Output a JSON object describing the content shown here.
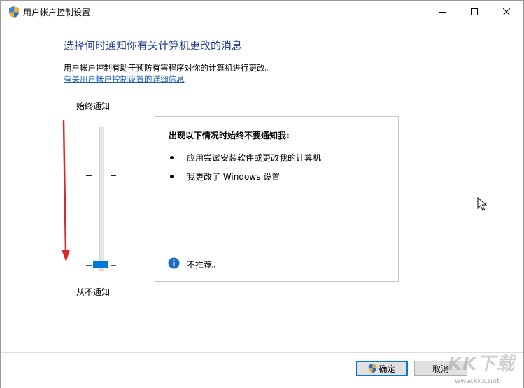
{
  "window": {
    "title": "用户帐户控制设置",
    "controls": {
      "minimize": "minimize-icon",
      "maximize": "maximize-icon",
      "close": "close-icon"
    }
  },
  "main": {
    "heading": "选择何时通知你有关计算机更改的消息",
    "description": "用户帐户控制有助于预防有害程序对你的计算机进行更改。",
    "link": "有关用户帐户控制设置的详细信息"
  },
  "slider": {
    "top_label": "始终通知",
    "bottom_label": "从不通知",
    "level_count": 4,
    "selected_level": 1
  },
  "info": {
    "title": "出现以下情况时始终不要通知我:",
    "bullets": [
      "应用尝试安装软件或更改我的计算机",
      "我更改了 Windows 设置"
    ],
    "recommendation": "不推荐。"
  },
  "buttons": {
    "ok": "确定",
    "cancel": "取消"
  },
  "colors": {
    "accent": "#0078d7",
    "heading": "#1e3c8c",
    "link": "#1a5fb4",
    "arrow": "#d9292b"
  },
  "watermark": {
    "main": "KK下载",
    "url": "www.kkx.net"
  }
}
